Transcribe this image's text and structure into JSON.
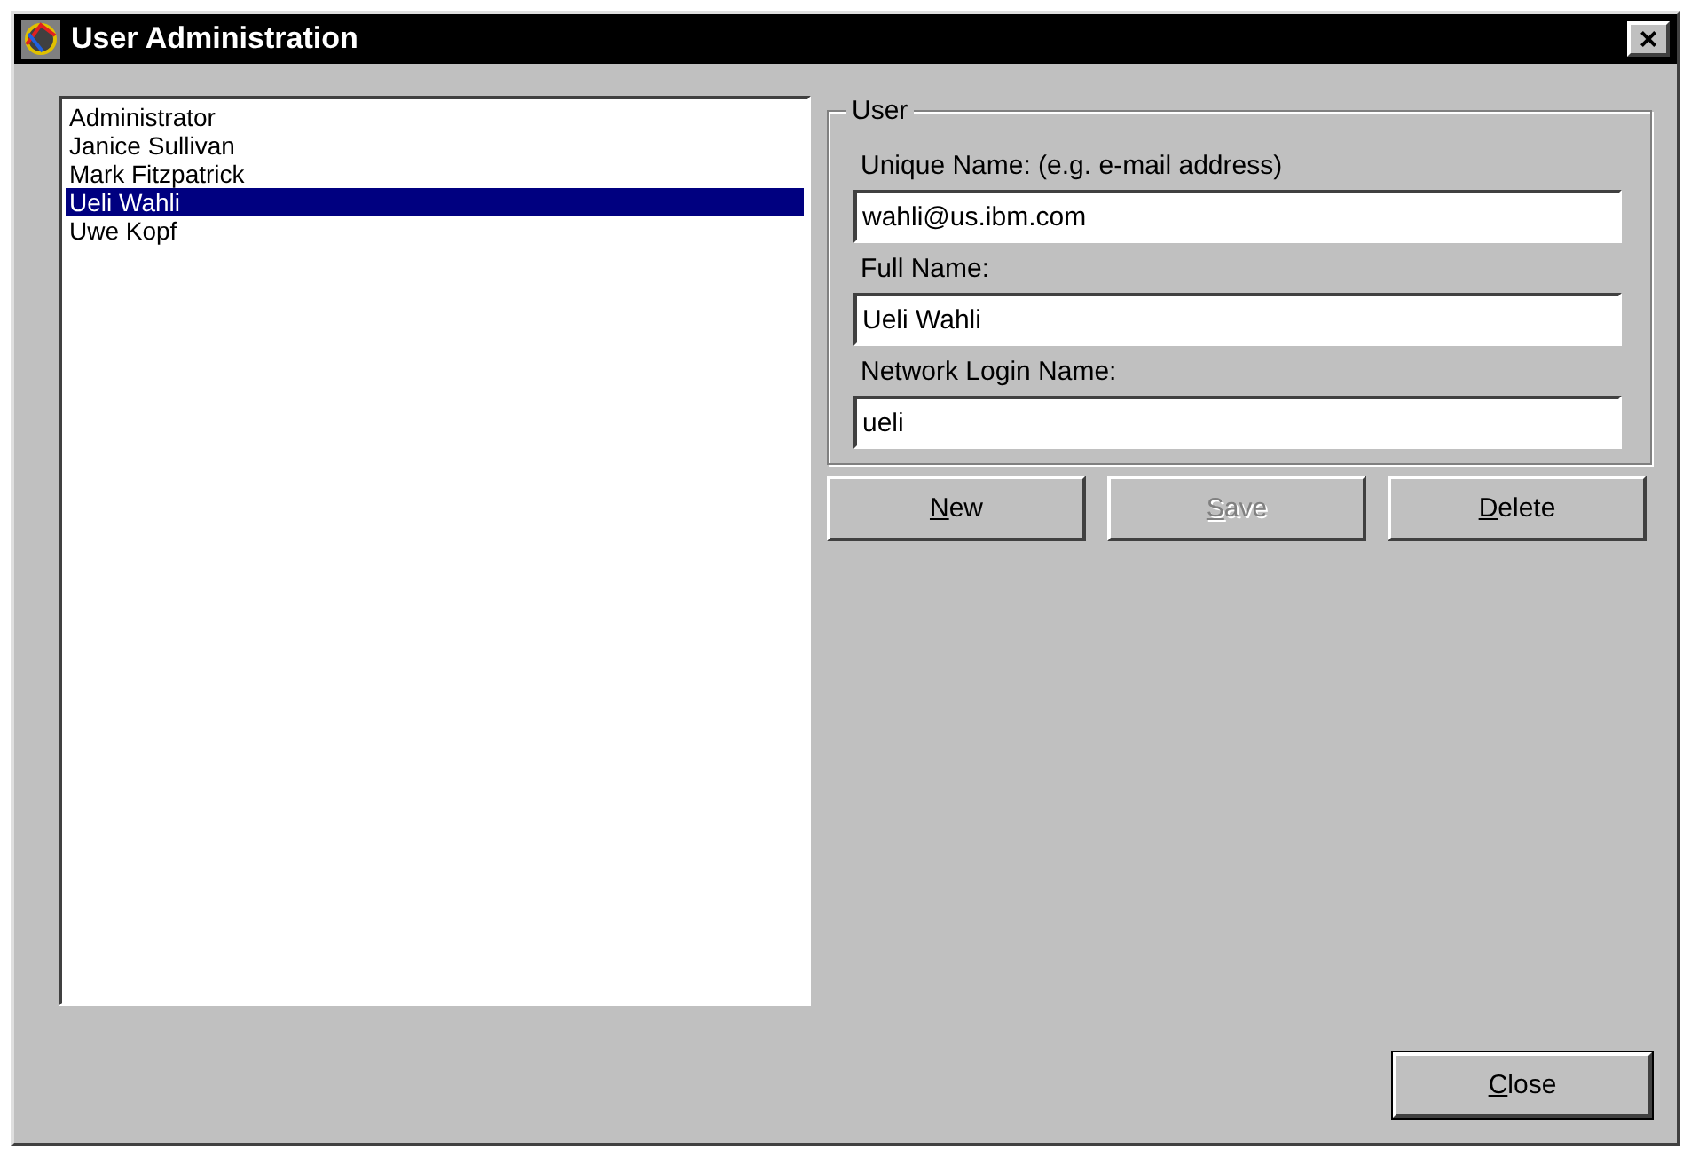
{
  "window": {
    "title": "User Administration",
    "close_label": "×"
  },
  "users": [
    {
      "name": "Administrator",
      "selected": false
    },
    {
      "name": "Janice Sullivan",
      "selected": false
    },
    {
      "name": "Mark Fitzpatrick",
      "selected": false
    },
    {
      "name": "Ueli Wahli",
      "selected": true
    },
    {
      "name": "Uwe Kopf",
      "selected": false
    }
  ],
  "user_group": {
    "title": "User",
    "fields": [
      {
        "label": "Unique Name: (e.g. e-mail address)",
        "value": "wahli@us.ibm.com"
      },
      {
        "label": "Full Name:",
        "value": "Ueli Wahli"
      },
      {
        "label": "Network Login Name:",
        "value": "ueli"
      }
    ]
  },
  "buttons": [
    {
      "label": "New",
      "disabled": false
    },
    {
      "label": "Save",
      "disabled": true
    },
    {
      "label": "Delete",
      "disabled": false
    }
  ],
  "close_button": {
    "label": "Close",
    "default": true
  }
}
